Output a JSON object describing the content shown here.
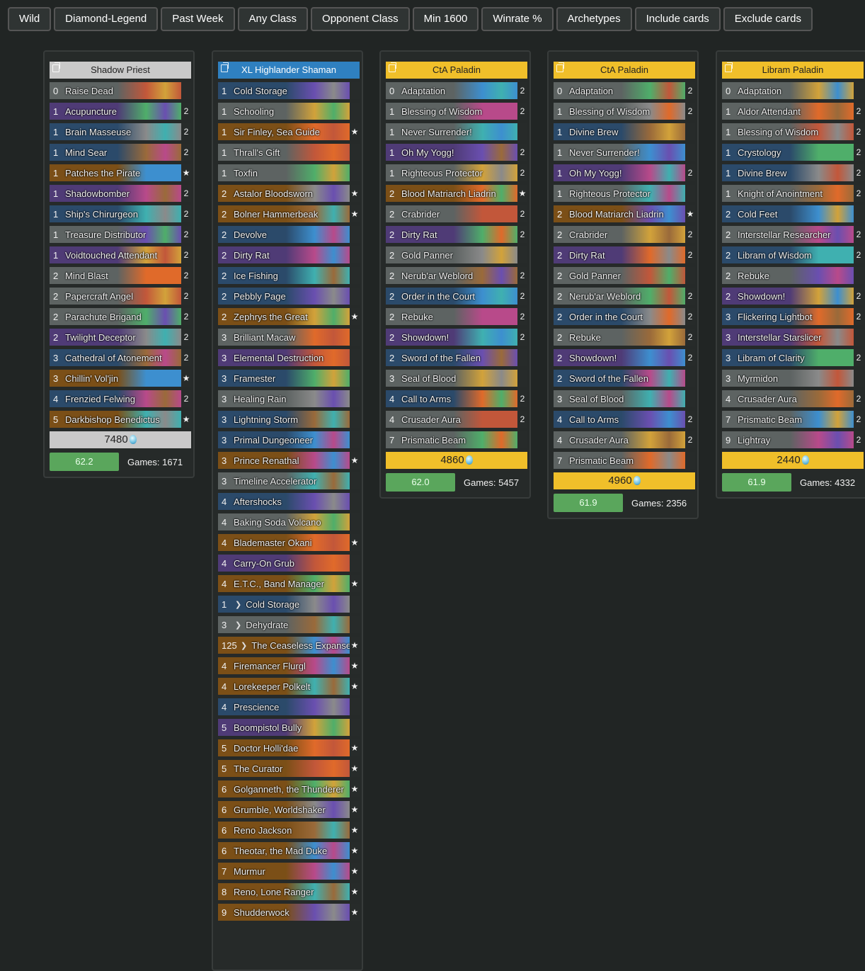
{
  "filters": [
    "Wild",
    "Diamond-Legend",
    "Past Week",
    "Any Class",
    "Opponent Class",
    "Min 1600",
    "Winrate %",
    "Archetypes",
    "Include cards",
    "Exclude cards"
  ],
  "decks": [
    {
      "title": "Shadow Priest",
      "title_bg": "#c9c9c9",
      "title_color": "#222222",
      "dust": "7480",
      "winrate": "62.2",
      "games": "Games: 1671",
      "cards": [
        {
          "cost": "0",
          "name": "Raise Dead",
          "count": "",
          "rarity": "common"
        },
        {
          "cost": "1",
          "name": "Acupuncture",
          "count": "2",
          "rarity": "epic"
        },
        {
          "cost": "1",
          "name": "Brain Masseuse",
          "count": "2",
          "rarity": "rare"
        },
        {
          "cost": "1",
          "name": "Mind Sear",
          "count": "2",
          "rarity": "rare"
        },
        {
          "cost": "1",
          "name": "Patches the Pirate",
          "count": "★",
          "rarity": "legendary"
        },
        {
          "cost": "1",
          "name": "Shadowbomber",
          "count": "2",
          "rarity": "epic"
        },
        {
          "cost": "1",
          "name": "Ship's Chirurgeon",
          "count": "2",
          "rarity": "rare"
        },
        {
          "cost": "1",
          "name": "Treasure Distributor",
          "count": "2",
          "rarity": "common"
        },
        {
          "cost": "1",
          "name": "Voidtouched Attendant",
          "count": "2",
          "rarity": "epic"
        },
        {
          "cost": "2",
          "name": "Mind Blast",
          "count": "2",
          "rarity": "common"
        },
        {
          "cost": "2",
          "name": "Papercraft Angel",
          "count": "2",
          "rarity": "common"
        },
        {
          "cost": "2",
          "name": "Parachute Brigand",
          "count": "2",
          "rarity": "common"
        },
        {
          "cost": "2",
          "name": "Twilight Deceptor",
          "count": "2",
          "rarity": "epic"
        },
        {
          "cost": "3",
          "name": "Cathedral of Atonement",
          "count": "2",
          "rarity": "rare"
        },
        {
          "cost": "3",
          "name": "Chillin' Vol'jin",
          "count": "★",
          "rarity": "legendary"
        },
        {
          "cost": "4",
          "name": "Frenzied Felwing",
          "count": "2",
          "rarity": "rare"
        },
        {
          "cost": "5",
          "name": "Darkbishop Benedictus",
          "count": "★",
          "rarity": "legendary"
        }
      ]
    },
    {
      "title": "XL Highlander Shaman",
      "title_bg": "#2f80c0",
      "title_color": "#ffffff",
      "dust": "",
      "winrate": "",
      "games": "",
      "cards": [
        {
          "cost": "1",
          "name": "Cold Storage",
          "count": "",
          "rarity": "rare"
        },
        {
          "cost": "1",
          "name": "Schooling",
          "count": "",
          "rarity": "common"
        },
        {
          "cost": "1",
          "name": "Sir Finley, Sea Guide",
          "count": "★",
          "rarity": "legendary"
        },
        {
          "cost": "1",
          "name": "Thrall's Gift",
          "count": "",
          "rarity": "common"
        },
        {
          "cost": "1",
          "name": "Toxfin",
          "count": "",
          "rarity": "common"
        },
        {
          "cost": "2",
          "name": "Astalor Bloodsworn",
          "count": "★",
          "rarity": "legendary"
        },
        {
          "cost": "2",
          "name": "Bolner Hammerbeak",
          "count": "★",
          "rarity": "legendary"
        },
        {
          "cost": "2",
          "name": "Devolve",
          "count": "",
          "rarity": "rare"
        },
        {
          "cost": "2",
          "name": "Dirty Rat",
          "count": "",
          "rarity": "epic"
        },
        {
          "cost": "2",
          "name": "Ice Fishing",
          "count": "",
          "rarity": "rare"
        },
        {
          "cost": "2",
          "name": "Pebbly Page",
          "count": "",
          "rarity": "rare"
        },
        {
          "cost": "2",
          "name": "Zephrys the Great",
          "count": "★",
          "rarity": "legendary"
        },
        {
          "cost": "3",
          "name": "Brilliant Macaw",
          "count": "",
          "rarity": "common"
        },
        {
          "cost": "3",
          "name": "Elemental Destruction",
          "count": "",
          "rarity": "epic"
        },
        {
          "cost": "3",
          "name": "Framester",
          "count": "",
          "rarity": "rare"
        },
        {
          "cost": "3",
          "name": "Healing Rain",
          "count": "",
          "rarity": "common"
        },
        {
          "cost": "3",
          "name": "Lightning Storm",
          "count": "",
          "rarity": "rare"
        },
        {
          "cost": "3",
          "name": "Primal Dungeoneer",
          "count": "",
          "rarity": "rare"
        },
        {
          "cost": "3",
          "name": "Prince Renathal",
          "count": "★",
          "rarity": "legendary"
        },
        {
          "cost": "3",
          "name": "Timeline Accelerator",
          "count": "",
          "rarity": "common"
        },
        {
          "cost": "4",
          "name": "Aftershocks",
          "count": "",
          "rarity": "rare"
        },
        {
          "cost": "4",
          "name": "Baking Soda Volcano",
          "count": "",
          "rarity": "common"
        },
        {
          "cost": "4",
          "name": "Blademaster Okani",
          "count": "★",
          "rarity": "legendary"
        },
        {
          "cost": "4",
          "name": "Carry-On Grub",
          "count": "",
          "rarity": "epic"
        },
        {
          "cost": "4",
          "name": "E.T.C., Band Manager",
          "count": "★",
          "rarity": "legendary"
        },
        {
          "cost": "1",
          "name": "Cold Storage",
          "count": "",
          "rarity": "rare",
          "sub": true
        },
        {
          "cost": "3",
          "name": "Dehydrate",
          "count": "",
          "rarity": "common",
          "sub": true
        },
        {
          "cost": "125",
          "name": "The Ceaseless Expanse",
          "count": "★",
          "rarity": "legendary",
          "sub": true
        },
        {
          "cost": "4",
          "name": "Firemancer Flurgl",
          "count": "★",
          "rarity": "legendary"
        },
        {
          "cost": "4",
          "name": "Lorekeeper Polkelt",
          "count": "★",
          "rarity": "legendary"
        },
        {
          "cost": "4",
          "name": "Prescience",
          "count": "",
          "rarity": "rare"
        },
        {
          "cost": "5",
          "name": "Boompistol Bully",
          "count": "",
          "rarity": "epic"
        },
        {
          "cost": "5",
          "name": "Doctor Holli'dae",
          "count": "★",
          "rarity": "legendary"
        },
        {
          "cost": "5",
          "name": "The Curator",
          "count": "★",
          "rarity": "legendary"
        },
        {
          "cost": "6",
          "name": "Golganneth, the Thunderer",
          "count": "★",
          "rarity": "legendary"
        },
        {
          "cost": "6",
          "name": "Grumble, Worldshaker",
          "count": "★",
          "rarity": "legendary"
        },
        {
          "cost": "6",
          "name": "Reno Jackson",
          "count": "★",
          "rarity": "legendary"
        },
        {
          "cost": "6",
          "name": "Theotar, the Mad Duke",
          "count": "★",
          "rarity": "legendary"
        },
        {
          "cost": "7",
          "name": "Murmur",
          "count": "★",
          "rarity": "legendary"
        },
        {
          "cost": "8",
          "name": "Reno, Lone Ranger",
          "count": "★",
          "rarity": "legendary"
        },
        {
          "cost": "9",
          "name": "Shudderwock",
          "count": "★",
          "rarity": "legendary"
        }
      ]
    },
    {
      "title": "CtA Paladin",
      "title_bg": "#f0bf2a",
      "title_color": "#222222",
      "dust": "4860",
      "winrate": "62.0",
      "games": "Games: 5457",
      "cards": [
        {
          "cost": "0",
          "name": "Adaptation",
          "count": "2",
          "rarity": "common"
        },
        {
          "cost": "1",
          "name": "Blessing of Wisdom",
          "count": "2",
          "rarity": "common"
        },
        {
          "cost": "1",
          "name": "Never Surrender!",
          "count": "",
          "rarity": "common"
        },
        {
          "cost": "1",
          "name": "Oh My Yogg!",
          "count": "2",
          "rarity": "epic"
        },
        {
          "cost": "1",
          "name": "Righteous Protector",
          "count": "2",
          "rarity": "common"
        },
        {
          "cost": "2",
          "name": "Blood Matriarch Liadrin",
          "count": "★",
          "rarity": "legendary"
        },
        {
          "cost": "2",
          "name": "Crabrider",
          "count": "2",
          "rarity": "common"
        },
        {
          "cost": "2",
          "name": "Dirty Rat",
          "count": "2",
          "rarity": "epic"
        },
        {
          "cost": "2",
          "name": "Gold Panner",
          "count": "",
          "rarity": "common"
        },
        {
          "cost": "2",
          "name": "Nerub'ar Weblord",
          "count": "2",
          "rarity": "common"
        },
        {
          "cost": "2",
          "name": "Order in the Court",
          "count": "2",
          "rarity": "rare"
        },
        {
          "cost": "2",
          "name": "Rebuke",
          "count": "2",
          "rarity": "common"
        },
        {
          "cost": "2",
          "name": "Showdown!",
          "count": "2",
          "rarity": "epic"
        },
        {
          "cost": "2",
          "name": "Sword of the Fallen",
          "count": "",
          "rarity": "rare"
        },
        {
          "cost": "3",
          "name": "Seal of Blood",
          "count": "",
          "rarity": "common"
        },
        {
          "cost": "4",
          "name": "Call to Arms",
          "count": "2",
          "rarity": "rare"
        },
        {
          "cost": "4",
          "name": "Crusader Aura",
          "count": "2",
          "rarity": "common"
        },
        {
          "cost": "7",
          "name": "Prismatic Beam",
          "count": "",
          "rarity": "common"
        }
      ]
    },
    {
      "title": "CtA Paladin",
      "title_bg": "#f0bf2a",
      "title_color": "#222222",
      "dust": "4960",
      "winrate": "61.9",
      "games": "Games: 2356",
      "cards": [
        {
          "cost": "0",
          "name": "Adaptation",
          "count": "2",
          "rarity": "common"
        },
        {
          "cost": "1",
          "name": "Blessing of Wisdom",
          "count": "2",
          "rarity": "common"
        },
        {
          "cost": "1",
          "name": "Divine Brew",
          "count": "",
          "rarity": "rare"
        },
        {
          "cost": "1",
          "name": "Never Surrender!",
          "count": "",
          "rarity": "common"
        },
        {
          "cost": "1",
          "name": "Oh My Yogg!",
          "count": "2",
          "rarity": "epic"
        },
        {
          "cost": "1",
          "name": "Righteous Protector",
          "count": "",
          "rarity": "common"
        },
        {
          "cost": "2",
          "name": "Blood Matriarch Liadrin",
          "count": "★",
          "rarity": "legendary"
        },
        {
          "cost": "2",
          "name": "Crabrider",
          "count": "2",
          "rarity": "common"
        },
        {
          "cost": "2",
          "name": "Dirty Rat",
          "count": "2",
          "rarity": "epic"
        },
        {
          "cost": "2",
          "name": "Gold Panner",
          "count": "",
          "rarity": "common"
        },
        {
          "cost": "2",
          "name": "Nerub'ar Weblord",
          "count": "2",
          "rarity": "common"
        },
        {
          "cost": "2",
          "name": "Order in the Court",
          "count": "2",
          "rarity": "rare"
        },
        {
          "cost": "2",
          "name": "Rebuke",
          "count": "2",
          "rarity": "common"
        },
        {
          "cost": "2",
          "name": "Showdown!",
          "count": "2",
          "rarity": "epic"
        },
        {
          "cost": "2",
          "name": "Sword of the Fallen",
          "count": "",
          "rarity": "rare"
        },
        {
          "cost": "3",
          "name": "Seal of Blood",
          "count": "",
          "rarity": "common"
        },
        {
          "cost": "4",
          "name": "Call to Arms",
          "count": "2",
          "rarity": "rare"
        },
        {
          "cost": "4",
          "name": "Crusader Aura",
          "count": "2",
          "rarity": "common"
        },
        {
          "cost": "7",
          "name": "Prismatic Beam",
          "count": "",
          "rarity": "common"
        }
      ]
    },
    {
      "title": "Libram Paladin",
      "title_bg": "#f0bf2a",
      "title_color": "#222222",
      "dust": "2440",
      "winrate": "61.9",
      "games": "Games: 4332",
      "cards": [
        {
          "cost": "0",
          "name": "Adaptation",
          "count": "",
          "rarity": "common"
        },
        {
          "cost": "1",
          "name": "Aldor Attendant",
          "count": "2",
          "rarity": "common"
        },
        {
          "cost": "1",
          "name": "Blessing of Wisdom",
          "count": "2",
          "rarity": "common"
        },
        {
          "cost": "1",
          "name": "Crystology",
          "count": "2",
          "rarity": "rare"
        },
        {
          "cost": "1",
          "name": "Divine Brew",
          "count": "2",
          "rarity": "rare"
        },
        {
          "cost": "1",
          "name": "Knight of Anointment",
          "count": "2",
          "rarity": "common"
        },
        {
          "cost": "2",
          "name": "Cold Feet",
          "count": "",
          "rarity": "rare"
        },
        {
          "cost": "2",
          "name": "Interstellar Researcher",
          "count": "2",
          "rarity": "common"
        },
        {
          "cost": "2",
          "name": "Libram of Wisdom",
          "count": "2",
          "rarity": "rare"
        },
        {
          "cost": "2",
          "name": "Rebuke",
          "count": "",
          "rarity": "common"
        },
        {
          "cost": "2",
          "name": "Showdown!",
          "count": "2",
          "rarity": "epic"
        },
        {
          "cost": "3",
          "name": "Flickering Lightbot",
          "count": "2",
          "rarity": "rare"
        },
        {
          "cost": "3",
          "name": "Interstellar Starslicer",
          "count": "",
          "rarity": "epic"
        },
        {
          "cost": "3",
          "name": "Libram of Clarity",
          "count": "2",
          "rarity": "rare"
        },
        {
          "cost": "3",
          "name": "Myrmidon",
          "count": "",
          "rarity": "common"
        },
        {
          "cost": "4",
          "name": "Crusader Aura",
          "count": "2",
          "rarity": "common"
        },
        {
          "cost": "7",
          "name": "Prismatic Beam",
          "count": "2",
          "rarity": "common"
        },
        {
          "cost": "9",
          "name": "Lightray",
          "count": "2",
          "rarity": "common"
        }
      ]
    }
  ],
  "art_palette": [
    "#c2573a",
    "#6a4fb0",
    "#3d8fcf",
    "#4fae6a",
    "#d2a23a",
    "#b84a8a",
    "#8a8a8a",
    "#e06a2a",
    "#3fb0b0",
    "#9a6a3a"
  ]
}
